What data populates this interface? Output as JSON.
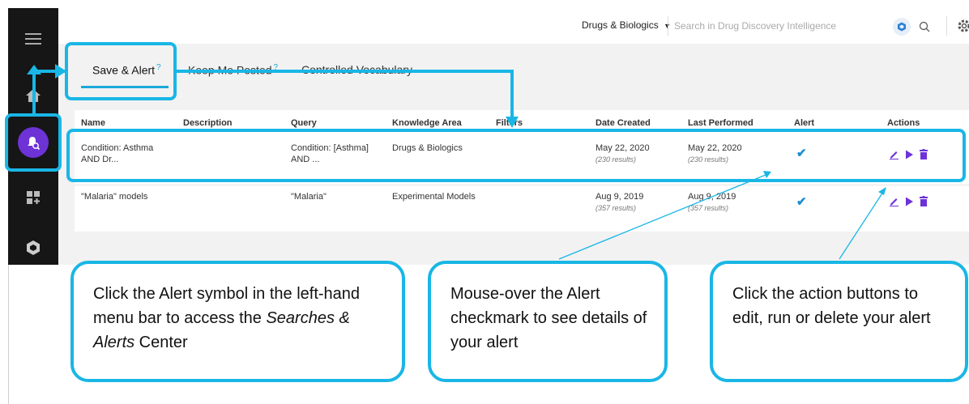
{
  "header": {
    "knowledge_dropdown": "Drugs & Biologics",
    "search_placeholder": "Search in Drug Discovery Intelligence"
  },
  "tabs": [
    {
      "label": "Save & Alert",
      "help": "?",
      "active": true
    },
    {
      "label": "Keep Me Posted",
      "help": "?",
      "active": false
    },
    {
      "label": "Controlled Vocabulary",
      "active": false
    }
  ],
  "table": {
    "columns": [
      "Name",
      "Description",
      "Query",
      "Knowledge Area",
      "Filters",
      "Date Created",
      "Last Performed",
      "Alert",
      "Actions"
    ],
    "rows": [
      {
        "name": "Condition: Asthma AND Dr...",
        "description": "",
        "query": "Condition: [Asthma] AND ...",
        "knowledge_area": "Drugs & Biologics",
        "filters": "",
        "date_created": "May 22, 2020",
        "date_created_results": "(230 results)",
        "last_performed": "May 22, 2020",
        "last_performed_results": "(230 results)",
        "alert": true
      },
      {
        "name": "\"Malaria\" models",
        "description": "",
        "query": "\"Malaria\"",
        "knowledge_area": "Experimental Models",
        "filters": "",
        "date_created": "Aug 9, 2019",
        "date_created_results": "(357 results)",
        "last_performed": "Aug 9, 2019",
        "last_performed_results": "(357 results)",
        "alert": true
      }
    ]
  },
  "callouts": {
    "c1": {
      "line1": "Click the Alert symbol in the left-hand menu bar to access the ",
      "emphasis": "Searches & Alerts",
      "line2": " Center"
    },
    "c2": "Mouse-over the Alert checkmark to see details of your alert",
    "c3": "Click the action buttons to edit, run or delete your alert"
  },
  "icons": {
    "sidebar": [
      "menu-icon",
      "home-icon",
      "alert-search-icon",
      "dashboard-icon",
      "logo-icon"
    ],
    "row_actions": [
      "edit-icon",
      "run-icon",
      "delete-icon"
    ]
  },
  "colors": {
    "sidebar_bg": "#161616",
    "accent_purple": "#6d33d6",
    "highlight_cyan": "#19b6e6",
    "check_blue": "#1a8dd1"
  }
}
